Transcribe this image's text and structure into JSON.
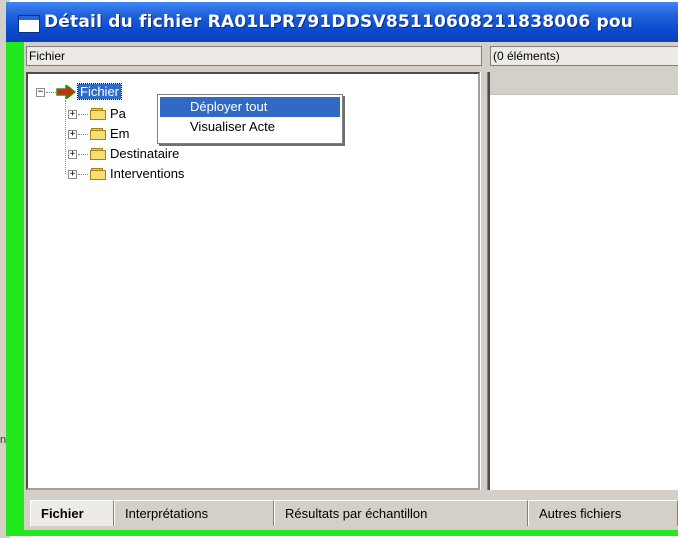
{
  "window": {
    "title": "Détail du fichier RA01LPR791DDSV8511060821183800​6 pou",
    "accent_color": "#22e81e",
    "titlebar_color": "#0a4bd0"
  },
  "panes": {
    "tree_header": "Fichier",
    "list_header": "(0 éléments)"
  },
  "tree": {
    "root": {
      "label": "Fichier",
      "icon": "red-arrow-icon",
      "expanded": true
    },
    "children": [
      {
        "label": "Pa",
        "icon": "folder-icon"
      },
      {
        "label": "Em",
        "icon": "folder-icon"
      },
      {
        "label": "Destinataire",
        "icon": "folder-icon"
      },
      {
        "label": "Interventions",
        "icon": "folder-icon"
      }
    ]
  },
  "context_menu": {
    "items": [
      {
        "label": "Déployer tout",
        "highlighted": true
      },
      {
        "label": "Visualiser Acte",
        "highlighted": false
      }
    ]
  },
  "tabs": [
    {
      "label": "Fichier",
      "active": true
    },
    {
      "label": "Interprétations",
      "active": false
    },
    {
      "label": "Résultats par échantillon",
      "active": false
    },
    {
      "label": "Autres fichiers",
      "active": false
    }
  ]
}
